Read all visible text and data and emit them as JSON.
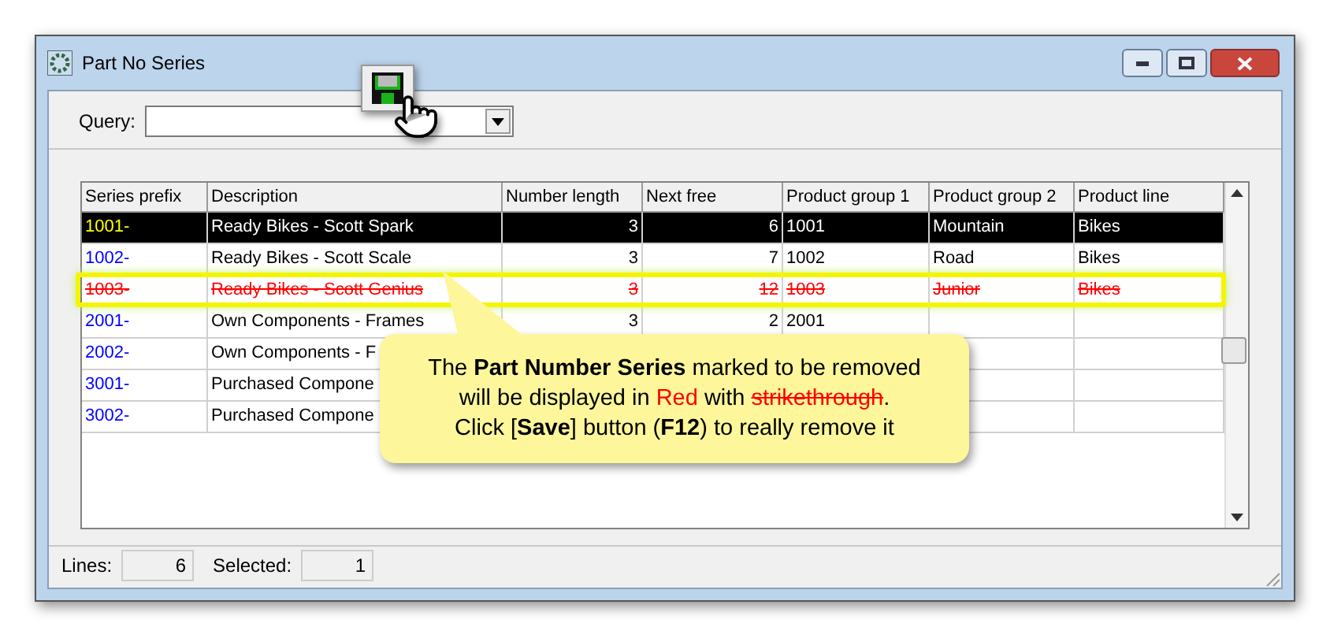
{
  "window": {
    "title": "Part No Series"
  },
  "query": {
    "label": "Query:"
  },
  "table": {
    "columns": [
      "Series prefix",
      "Description",
      "Number length",
      "Next free",
      "Product group 1",
      "Product group 2",
      "Product line"
    ],
    "rows": [
      {
        "selected": true,
        "removed": false,
        "cells": [
          "1001-",
          "Ready Bikes - Scott Spark",
          "3",
          "6",
          "1001",
          "Mountain",
          "Bikes"
        ]
      },
      {
        "selected": false,
        "removed": false,
        "cells": [
          "1002-",
          "Ready Bikes - Scott Scale",
          "3",
          "7",
          "1002",
          "Road",
          "Bikes"
        ]
      },
      {
        "selected": false,
        "removed": true,
        "cells": [
          "1003-",
          "Ready Bikes - Scott Genius",
          "3",
          "12",
          "1003",
          "Junior",
          "Bikes"
        ]
      },
      {
        "selected": false,
        "removed": false,
        "cells": [
          "2001-",
          "Own Components - Frames",
          "3",
          "2",
          "2001"
        ]
      },
      {
        "selected": false,
        "removed": false,
        "cells": [
          "2002-",
          "Own Components - F"
        ]
      },
      {
        "selected": false,
        "removed": false,
        "cells": [
          "3001-",
          "Purchased Compone"
        ]
      },
      {
        "selected": false,
        "removed": false,
        "cells": [
          "3002-",
          "Purchased Compone"
        ]
      }
    ]
  },
  "callout": {
    "lines": [
      [
        {
          "kind": "plain",
          "text": "The "
        },
        {
          "kind": "bold",
          "text": "Part Number Series"
        },
        {
          "kind": "plain",
          "text": " marked to be removed"
        }
      ],
      [
        {
          "kind": "plain",
          "text": "will be displayed in "
        },
        {
          "kind": "red",
          "text": "Red"
        },
        {
          "kind": "plain",
          "text": " with "
        },
        {
          "kind": "strike",
          "text": "strikethrough"
        },
        {
          "kind": "plain",
          "text": "."
        }
      ],
      [
        {
          "kind": "plain",
          "text": "Click ["
        },
        {
          "kind": "bold",
          "text": "Save"
        },
        {
          "kind": "plain",
          "text": "] button ("
        },
        {
          "kind": "bold",
          "text": "F12"
        },
        {
          "kind": "plain",
          "text": ") to really remove it"
        }
      ]
    ]
  },
  "status_bar": {
    "lines_label": "Lines:",
    "lines": "6",
    "selected_label": "Selected:",
    "selected": "1"
  }
}
